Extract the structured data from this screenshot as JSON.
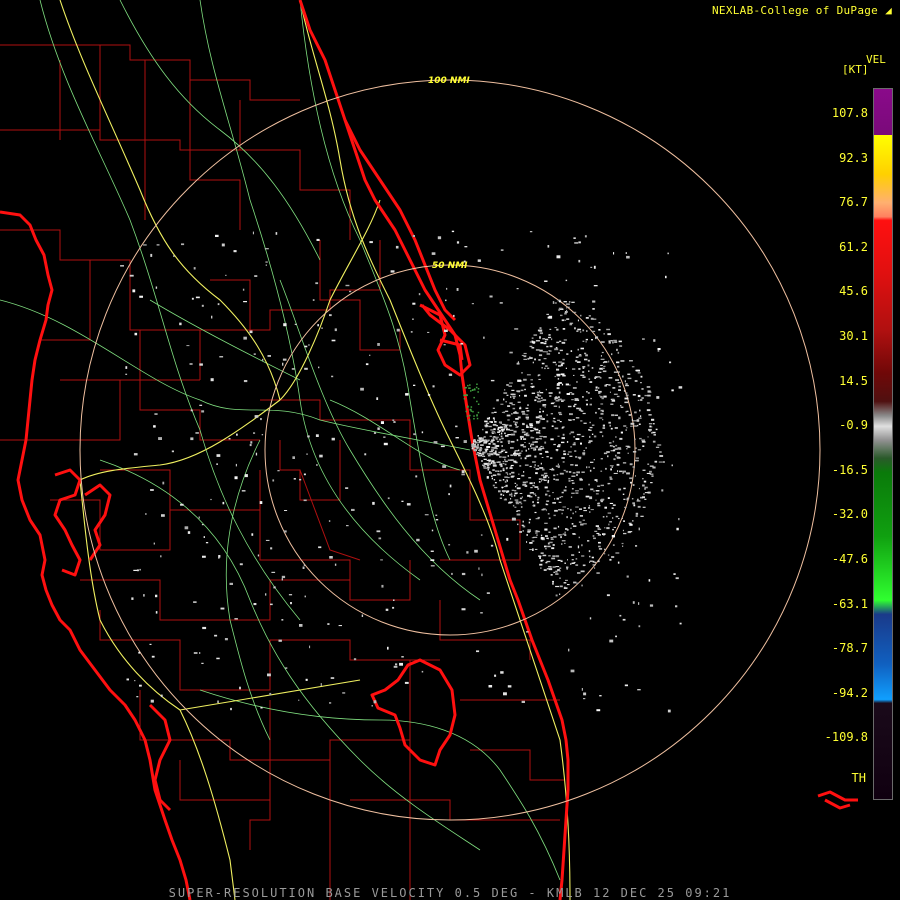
{
  "brand": "NEXLAB-College of DuPage",
  "footer": "SUPER-RESOLUTION BASE VELOCITY 0.5 DEG - KMLB 12 DEC 25 09:21",
  "legend": {
    "product": "VEL",
    "unit": "[KT]",
    "values": [
      "107.8",
      "92.3",
      "76.7",
      "61.2",
      "45.6",
      "30.1",
      "14.5",
      "-0.9",
      "-16.5",
      "-32.0",
      "-47.6",
      "-63.1",
      "-78.7",
      "-94.2",
      "-109.8",
      "TH"
    ]
  },
  "range_rings": [
    "100 NMI",
    "50 NMI"
  ],
  "colors": {
    "text": "#ffff33",
    "county_lines": "#b01010",
    "roads": "#80e080",
    "interstates": "#f0f060",
    "coast": "#ff1010",
    "rings": "#f0c0a0"
  }
}
